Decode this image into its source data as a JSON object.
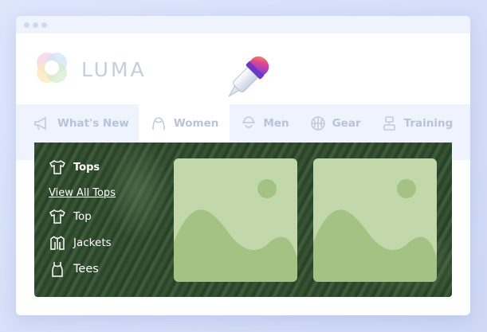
{
  "brand": {
    "name": "LUMA"
  },
  "nav": {
    "items": [
      {
        "label": "What's New",
        "icon": "megaphone-icon"
      },
      {
        "label": "Women",
        "icon": "women-icon",
        "active": true
      },
      {
        "label": "Men",
        "icon": "men-icon"
      },
      {
        "label": "Gear",
        "icon": "basketball-icon"
      },
      {
        "label": "Training",
        "icon": "training-icon"
      }
    ]
  },
  "dropdown": {
    "category": "Tops",
    "view_all": "View All Tops",
    "subcategories": [
      {
        "label": "Top",
        "icon": "tshirt-icon"
      },
      {
        "label": "Jackets",
        "icon": "jacket-icon"
      },
      {
        "label": "Tees",
        "icon": "tank-top-icon"
      }
    ]
  },
  "colors": {
    "nav_text": "#b8c3d7",
    "nav_background": "#eef3fd",
    "thumbnail_fill": "#c3d8aa",
    "thumbnail_shape": "#a3c283"
  },
  "overlay_icon": "color-dropper-icon"
}
